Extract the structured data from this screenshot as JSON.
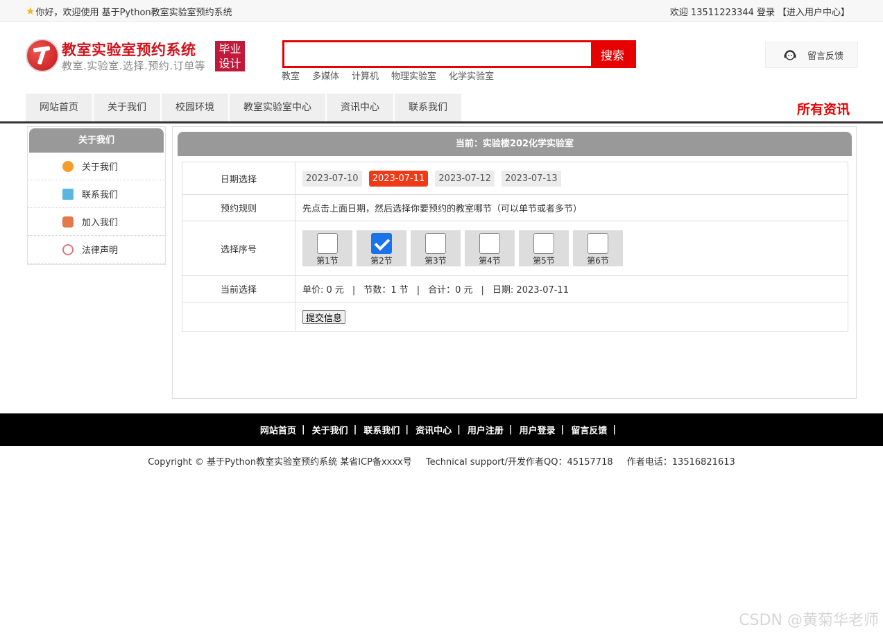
{
  "topbar": {
    "greeting": "你好，欢迎使用 基于Python教室实验室预约系统",
    "welcome_user": "欢迎 13511223344",
    "login": "登录",
    "user_center": "【进入用户中心】"
  },
  "header": {
    "title": "教室实验室预约系统",
    "subtitle": "教室.实验室.选择.预约.订单等",
    "badge_line1": "毕业",
    "badge_line2": "设计",
    "search_placeholder": "",
    "search_button": "搜索",
    "hotwords": [
      "教室",
      "多媒体",
      "计算机",
      "物理实验室",
      "化学实验室"
    ],
    "feedback": "留言反馈"
  },
  "nav": {
    "items": [
      "网站首页",
      "关于我们",
      "校园环境",
      "教室实验室中心",
      "资讯中心",
      "联系我们"
    ],
    "right": "所有资讯"
  },
  "sidebar": {
    "title": "关于我们",
    "items": [
      "关于我们",
      "联系我们",
      "加入我们",
      "法律声明"
    ]
  },
  "main": {
    "current": "当前：实验楼202化学实验室",
    "date_label": "日期选择",
    "dates": [
      "2023-07-10",
      "2023-07-11",
      "2023-07-12",
      "2023-07-13"
    ],
    "rule_label": "预约规则",
    "rule_text": "先点击上面日期，然后选择你要预约的教室哪节（可以单节或者多节）",
    "slot_label": "选择序号",
    "slots": [
      {
        "label": "第1节",
        "checked": false
      },
      {
        "label": "第2节",
        "checked": true
      },
      {
        "label": "第3节",
        "checked": false
      },
      {
        "label": "第4节",
        "checked": false
      },
      {
        "label": "第5节",
        "checked": false
      },
      {
        "label": "第6节",
        "checked": false
      }
    ],
    "current_label": "当前选择",
    "unit_price": "单价: 0 元",
    "sessions": "节数：1 节",
    "total": "合计：0 元",
    "date": "日期: 2023-07-11",
    "divider": "|",
    "submit": "提交信息"
  },
  "footer": {
    "links": [
      "网站首页",
      "关于我们",
      "联系我们",
      "资讯中心",
      "用户注册",
      "用户登录",
      "留言反馈"
    ],
    "separator": "|",
    "copyright": "Copyright © 基于Python教室实验室预约系统 某省ICP备xxxx号",
    "support": "Technical support/开发作者QQ：45157718",
    "phone": "作者电话：13516821613"
  },
  "watermark": "CSDN @黄菊华老师",
  "colors": {
    "accent": "#e60000",
    "active_date": "#f03a17",
    "panel_header": "#999999",
    "badge": "#c1193a",
    "checkbox_checked": "#1a73e8"
  }
}
